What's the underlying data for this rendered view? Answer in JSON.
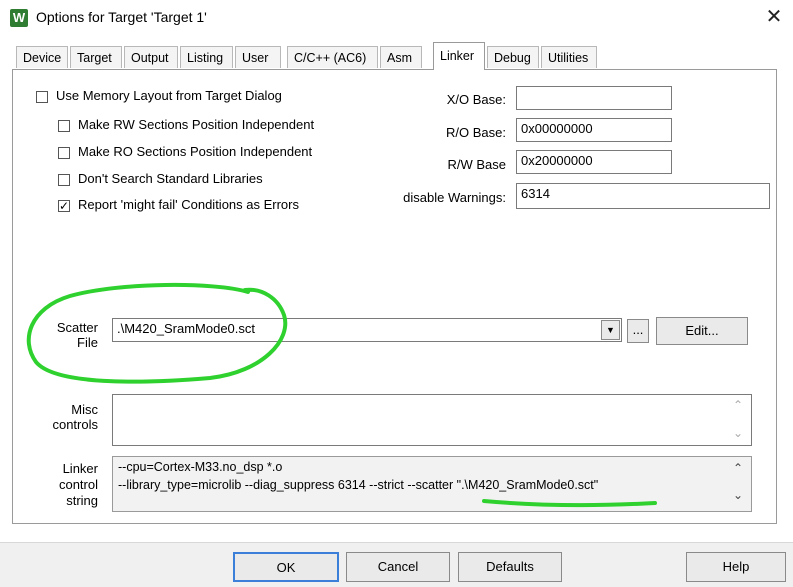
{
  "window": {
    "title": "Options for Target 'Target 1'",
    "icon": "uvision-app-icon",
    "close_glyph": "✕"
  },
  "tabs": [
    {
      "label": "Device"
    },
    {
      "label": "Target"
    },
    {
      "label": "Output"
    },
    {
      "label": "Listing"
    },
    {
      "label": "User"
    },
    {
      "label": "C/C++ (AC6)"
    },
    {
      "label": "Asm"
    },
    {
      "label": "Linker",
      "active": true
    },
    {
      "label": "Debug"
    },
    {
      "label": "Utilities"
    }
  ],
  "options": {
    "use_memory_layout": {
      "label": "Use Memory Layout from Target Dialog",
      "checked": false
    },
    "rw_independent": {
      "label": "Make RW Sections Position Independent",
      "checked": false
    },
    "ro_independent": {
      "label": "Make RO Sections Position Independent",
      "checked": false
    },
    "dont_search_std": {
      "label": "Don't Search Standard Libraries",
      "checked": false
    },
    "report_might_fail": {
      "label": "Report 'might fail' Conditions as Errors",
      "checked": true
    }
  },
  "addresses": {
    "xo_base": {
      "label": "X/O Base:",
      "value": ""
    },
    "ro_base": {
      "label": "R/O Base:",
      "value": "0x00000000"
    },
    "rw_base": {
      "label": "R/W Base",
      "value": "0x20000000"
    },
    "disable_warnings": {
      "label": "disable Warnings:",
      "value": "6314"
    }
  },
  "scatter": {
    "label_line1": "Scatter",
    "label_line2": "File",
    "value": ".\\M420_SramMode0.sct",
    "browse_label": "...",
    "edit_label": "Edit..."
  },
  "misc": {
    "label_line1": "Misc",
    "label_line2": "controls",
    "value": ""
  },
  "linker_string": {
    "label_line1": "Linker",
    "label_line2": "control",
    "label_line3": "string",
    "line1": "--cpu=Cortex-M33.no_dsp *.o",
    "line2": "--library_type=microlib --diag_suppress 6314 --strict --scatter \".\\M420_SramMode0.sct\""
  },
  "buttons": {
    "ok": "OK",
    "cancel": "Cancel",
    "defaults": "Defaults",
    "help": "Help"
  },
  "annotation": {
    "color": "#2fd12f"
  }
}
